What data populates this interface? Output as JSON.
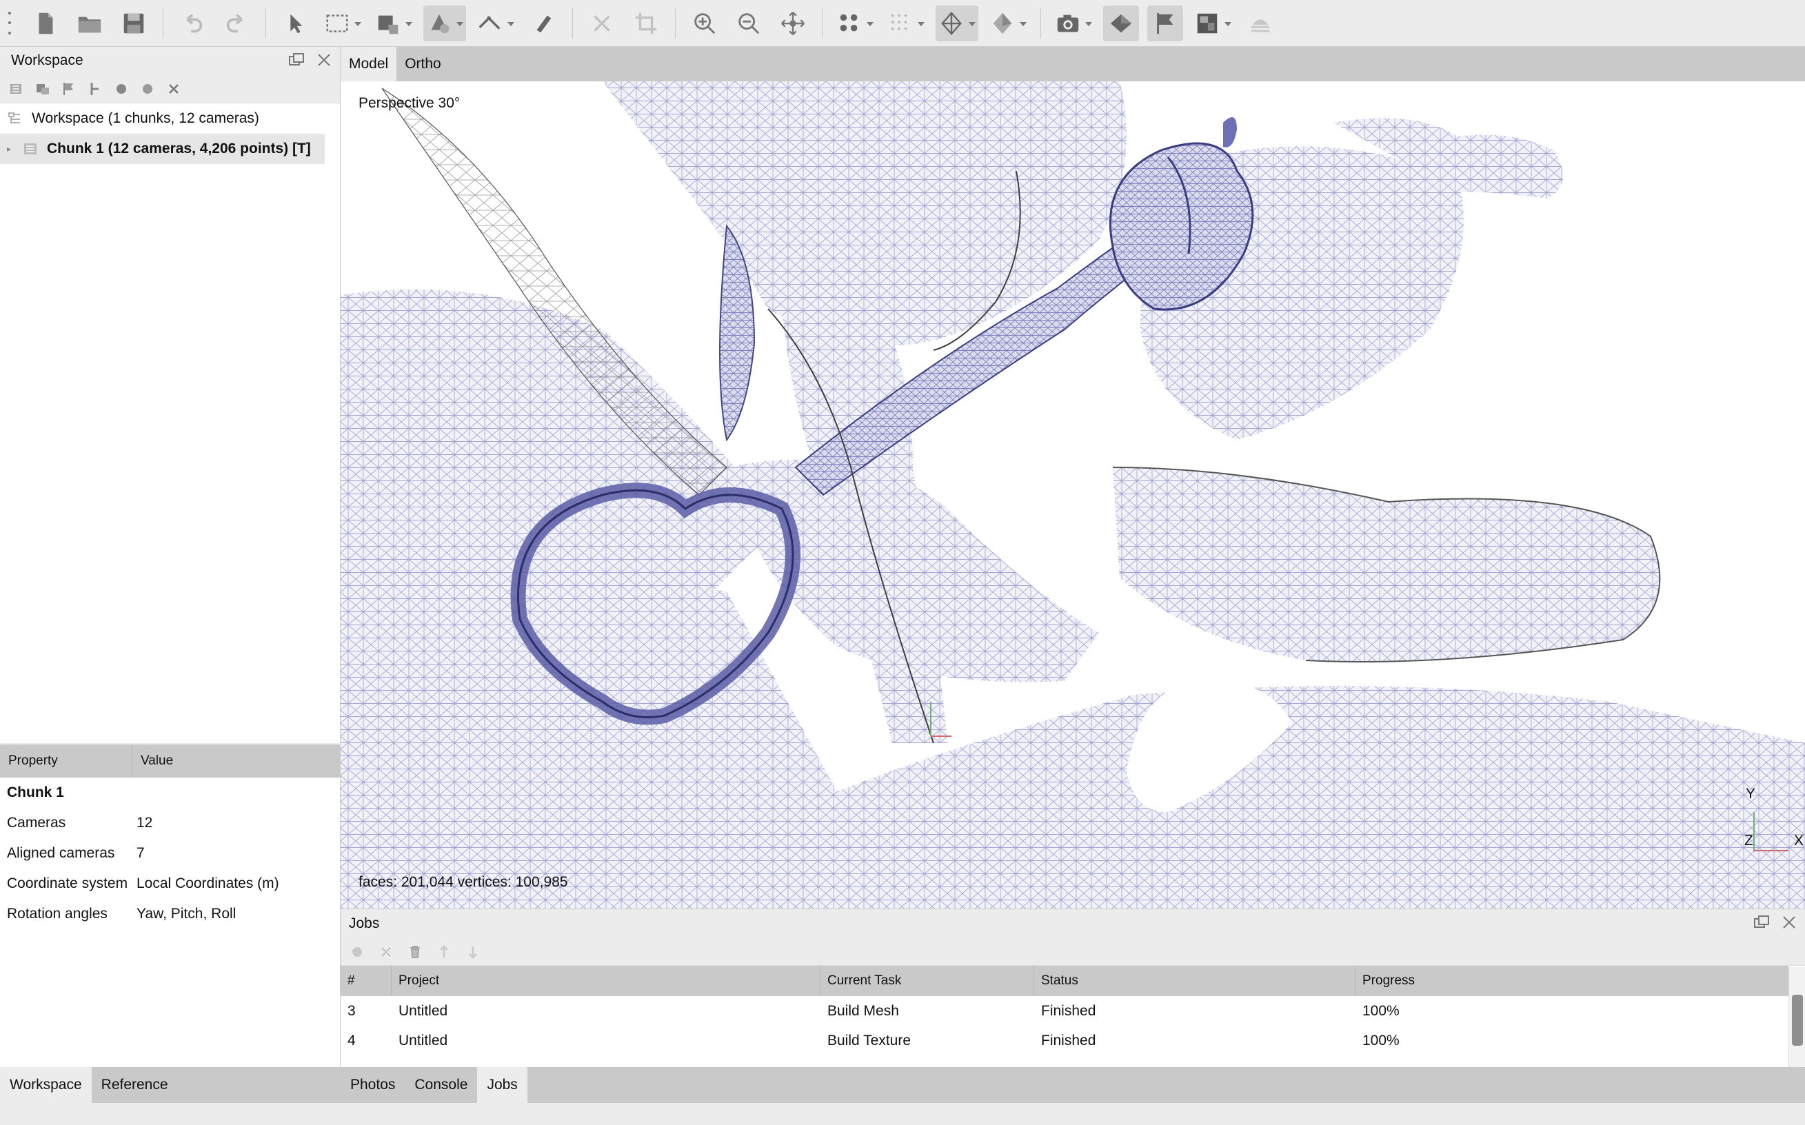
{
  "toolbar": {
    "icons": [
      "menu-grip",
      "new-document",
      "open-folder",
      "save",
      "undo",
      "redo",
      "navigation-pointer",
      "rectangle-selection",
      "crop-selection",
      "draw-polygon",
      "ruler",
      "measure",
      "delete",
      "crop",
      "zoom-in",
      "zoom-out",
      "move-object",
      "show-points",
      "show-dense-cloud",
      "show-mesh",
      "show-solid",
      "capture-view",
      "show-cameras",
      "show-markers",
      "show-dem",
      "show-shapes"
    ]
  },
  "workspace": {
    "title": "Workspace",
    "root_label": "Workspace (1 chunks, 12 cameras)",
    "chunk_label": "Chunk 1 (12 cameras, 4,206 points) [T]"
  },
  "properties": {
    "header_property": "Property",
    "header_value": "Value",
    "group": "Chunk 1",
    "rows": [
      {
        "key": "Cameras",
        "value": "12"
      },
      {
        "key": "Aligned cameras",
        "value": "7"
      },
      {
        "key": "Coordinate system",
        "value": "Local Coordinates (m)"
      },
      {
        "key": "Rotation angles",
        "value": "Yaw, Pitch, Roll"
      }
    ]
  },
  "left_tabs": [
    "Workspace",
    "Reference"
  ],
  "view_tabs": [
    "Model",
    "Ortho"
  ],
  "viewport": {
    "projection": "Perspective 30°",
    "stats": "faces: 201,044 vertices: 100,985",
    "axis_y": "Y",
    "axis_x": "X",
    "axis_z": "Z",
    "mesh_color": "#8c8fc7"
  },
  "jobs": {
    "title": "Jobs",
    "columns": [
      "#",
      "Project",
      "Current Task",
      "Status",
      "Progress"
    ],
    "rows": [
      {
        "num": "3",
        "project": "Untitled",
        "task": "Build Mesh",
        "status": "Finished",
        "progress": "100%"
      },
      {
        "num": "4",
        "project": "Untitled",
        "task": "Build Texture",
        "status": "Finished",
        "progress": "100%"
      }
    ]
  },
  "right_tabs": [
    "Photos",
    "Console",
    "Jobs"
  ]
}
